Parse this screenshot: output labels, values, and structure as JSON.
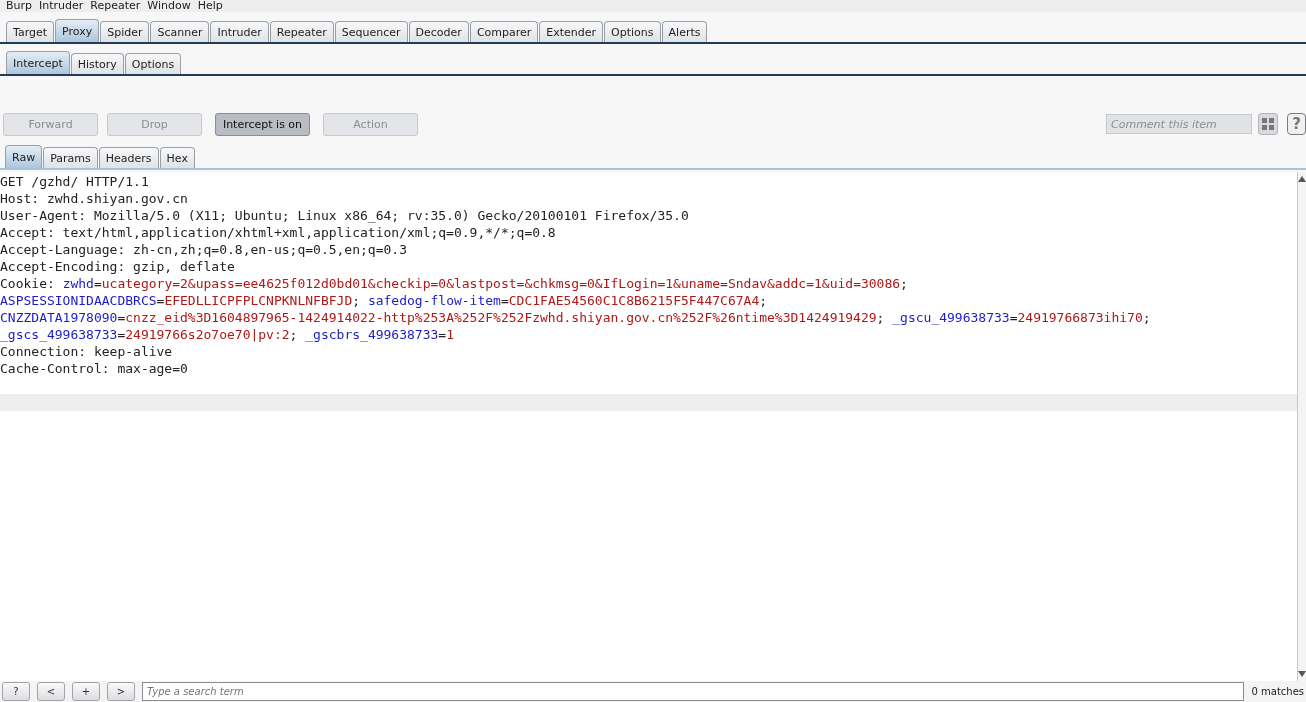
{
  "menu": [
    "Burp",
    "Intruder",
    "Repeater",
    "Window",
    "Help"
  ],
  "main_tabs": [
    {
      "label": "Target",
      "selected": false
    },
    {
      "label": "Proxy",
      "selected": true
    },
    {
      "label": "Spider",
      "selected": false
    },
    {
      "label": "Scanner",
      "selected": false
    },
    {
      "label": "Intruder",
      "selected": false
    },
    {
      "label": "Repeater",
      "selected": false
    },
    {
      "label": "Sequencer",
      "selected": false
    },
    {
      "label": "Decoder",
      "selected": false
    },
    {
      "label": "Comparer",
      "selected": false
    },
    {
      "label": "Extender",
      "selected": false
    },
    {
      "label": "Options",
      "selected": false
    },
    {
      "label": "Alerts",
      "selected": false
    }
  ],
  "sub_tabs": [
    {
      "label": "Intercept",
      "selected": true
    },
    {
      "label": "History",
      "selected": false
    },
    {
      "label": "Options",
      "selected": false
    }
  ],
  "actions": [
    {
      "label": "Forward",
      "disabled": true,
      "on": false
    },
    {
      "label": "Drop",
      "disabled": true,
      "on": false
    },
    {
      "label": "Intercept is on",
      "disabled": false,
      "on": true
    },
    {
      "label": "Action",
      "disabled": true,
      "on": false
    }
  ],
  "comment": {
    "placeholder": "Comment this item"
  },
  "help_button": "?",
  "message_tabs": [
    {
      "label": "Raw",
      "selected": true
    },
    {
      "label": "Params",
      "selected": false
    },
    {
      "label": "Headers",
      "selected": false
    },
    {
      "label": "Hex",
      "selected": false
    }
  ],
  "request_lines": [
    [
      {
        "kind": "text",
        "text": "GET /gzhd/ HTTP/1.1"
      }
    ],
    [
      {
        "kind": "text",
        "text": "Host: zwhd.shiyan.gov.cn"
      }
    ],
    [
      {
        "kind": "text",
        "text": "User-Agent: Mozilla/5.0 (X11; Ubuntu; Linux x86_64; rv:35.0) Gecko/20100101 Firefox/35.0"
      }
    ],
    [
      {
        "kind": "text",
        "text": "Accept: text/html,application/xhtml+xml,application/xml;q=0.9,*/*;q=0.8"
      }
    ],
    [
      {
        "kind": "text",
        "text": "Accept-Language: zh-cn,zh;q=0.8,en-us;q=0.5,en;q=0.3"
      }
    ],
    [
      {
        "kind": "text",
        "text": "Accept-Encoding: gzip, deflate"
      }
    ],
    [
      {
        "kind": "text",
        "text": "Cookie: "
      },
      {
        "kind": "name",
        "text": "zwhd"
      },
      {
        "kind": "text",
        "text": "="
      },
      {
        "kind": "value",
        "text": "ucategory=2&upass=ee4625f012d0bd01&checkip=0&lastpost=&chkmsg=0&IfLogin=1&uname=Sndav&addc=1&uid=30086"
      },
      {
        "kind": "text",
        "text": ";"
      }
    ],
    [
      {
        "kind": "name",
        "text": "ASPSESSIONIDAACDBRCS"
      },
      {
        "kind": "text",
        "text": "="
      },
      {
        "kind": "value",
        "text": "EFEDLLICPFPLCNPKNLNFBFJD"
      },
      {
        "kind": "text",
        "text": "; "
      },
      {
        "kind": "name",
        "text": "safedog-flow-item"
      },
      {
        "kind": "text",
        "text": "="
      },
      {
        "kind": "value",
        "text": "CDC1FAE54560C1C8B6215F5F447C67A4"
      },
      {
        "kind": "text",
        "text": ";"
      }
    ],
    [
      {
        "kind": "name",
        "text": "CNZZDATA1978090"
      },
      {
        "kind": "text",
        "text": "="
      },
      {
        "kind": "value",
        "text": "cnzz_eid%3D1604897965-1424914022-http%253A%252F%252Fzwhd.shiyan.gov.cn%252F%26ntime%3D1424919429"
      },
      {
        "kind": "text",
        "text": "; "
      },
      {
        "kind": "name",
        "text": "_gscu_499638733"
      },
      {
        "kind": "text",
        "text": "="
      },
      {
        "kind": "value",
        "text": "24919766873ihi70"
      },
      {
        "kind": "text",
        "text": ";"
      }
    ],
    [
      {
        "kind": "name",
        "text": "_gscs_499638733"
      },
      {
        "kind": "text",
        "text": "="
      },
      {
        "kind": "value",
        "text": "24919766s2o7oe70|pv:2"
      },
      {
        "kind": "text",
        "text": "; "
      },
      {
        "kind": "name",
        "text": "_gscbrs_499638733"
      },
      {
        "kind": "text",
        "text": "="
      },
      {
        "kind": "value",
        "text": "1"
      }
    ],
    [
      {
        "kind": "text",
        "text": "Connection: keep-alive"
      }
    ],
    [
      {
        "kind": "text",
        "text": "Cache-Control: max-age=0"
      }
    ]
  ],
  "search_bar": {
    "buttons": [
      "?",
      "<",
      "+",
      ">"
    ],
    "placeholder": "Type a search term",
    "matches": "0 matches"
  }
}
